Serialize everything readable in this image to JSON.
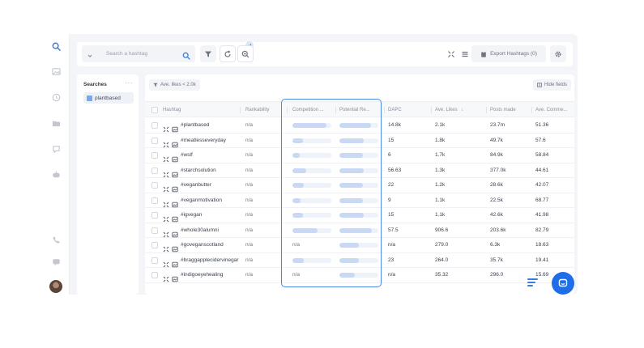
{
  "topbar": {
    "search_placeholder": "Search a hashtag",
    "export_label": "Export Hashtags (0)"
  },
  "searches": {
    "title": "Searches",
    "more": "···",
    "items": [
      {
        "label": "plantbased"
      }
    ]
  },
  "filters": {
    "chip_label": "Ave. likes < 2.0k",
    "hide_fields_label": "Hide fields"
  },
  "table": {
    "columns": {
      "hashtag": "Hashtag",
      "rankability": "Rankability",
      "competition": "Competition ...",
      "potential": "Potential Re...",
      "dapc": "DAPC",
      "ave_likes": "Ave. Likes",
      "posts_made": "Posts made",
      "ave_comments": "Ave. Comme..."
    },
    "sort_indicator": "↓",
    "rows": [
      {
        "hashtag": "#plantbased",
        "rankability": "n/a",
        "competition": 0.88,
        "potential": 0.82,
        "dapc": "14.8k",
        "ave_likes": "2.1k",
        "posts_made": "23.7m",
        "ave_comments": "51.36"
      },
      {
        "hashtag": "#meatlesseveryday",
        "rankability": "n/a",
        "competition": 0.28,
        "potential": 0.62,
        "dapc": "15",
        "ave_likes": "1.8k",
        "posts_made": "49.7k",
        "ave_comments": "57.6"
      },
      {
        "hashtag": "#wslf",
        "rankability": "n/a",
        "competition": 0.18,
        "potential": 0.6,
        "dapc": "6",
        "ave_likes": "1.7k",
        "posts_made": "84.9k",
        "ave_comments": "58.84"
      },
      {
        "hashtag": "#starchsolution",
        "rankability": "n/a",
        "competition": 0.36,
        "potential": 0.62,
        "dapc": "56.63",
        "ave_likes": "1.3k",
        "posts_made": "377.0k",
        "ave_comments": "44.61"
      },
      {
        "hashtag": "#veganbutter",
        "rankability": "n/a",
        "competition": 0.3,
        "potential": 0.6,
        "dapc": "22",
        "ave_likes": "1.2k",
        "posts_made": "28.6k",
        "ave_comments": "42.07"
      },
      {
        "hashtag": "#veganmotivation",
        "rankability": "n/a",
        "competition": 0.2,
        "potential": 0.6,
        "dapc": "9",
        "ave_likes": "1.1k",
        "posts_made": "22.5k",
        "ave_comments": "68.77"
      },
      {
        "hashtag": "#igvegan",
        "rankability": "n/a",
        "competition": 0.28,
        "potential": 0.62,
        "dapc": "15",
        "ave_likes": "1.1k",
        "posts_made": "42.6k",
        "ave_comments": "41.98"
      },
      {
        "hashtag": "#whole30alumni",
        "rankability": "n/a",
        "competition": 0.64,
        "potential": 0.84,
        "dapc": "57.5",
        "ave_likes": "906.6",
        "posts_made": "203.6k",
        "ave_comments": "82.79"
      },
      {
        "hashtag": "#goveganscotland",
        "rankability": "n/a",
        "competition_text": "n/a",
        "potential": 0.5,
        "dapc": "n/a",
        "ave_likes": "279.0",
        "posts_made": "6.3k",
        "ave_comments": "18.63"
      },
      {
        "hashtag": "#braggapplecidervinegar",
        "rankability": "n/a",
        "competition": 0.3,
        "potential": 0.5,
        "dapc": "23",
        "ave_likes": "264.0",
        "posts_made": "35.7k",
        "ave_comments": "19.41"
      },
      {
        "hashtag": "#indigoeyehealing",
        "rankability": "n/a",
        "competition_text": "n/a",
        "potential": 0.4,
        "dapc": "n/a",
        "ave_likes": "35.32",
        "posts_made": "296.0",
        "ave_comments": "15.69"
      }
    ]
  },
  "colors": {
    "accent": "#3b7ddd",
    "highlight_border": "#4a88e6",
    "bar_fill": "#c9d8f3",
    "bar_track": "#eef2f9",
    "chat_button": "#1f6ee8"
  }
}
